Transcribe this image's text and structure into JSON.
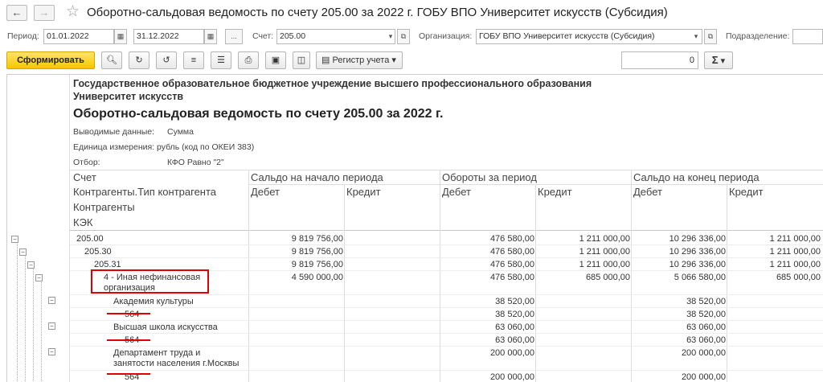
{
  "window": {
    "title": "Оборотно-сальдовая ведомость по счету 205.00 за 2022 г. ГОБУ ВПО Университет искусств (Субсидия)",
    "back_icon": "arrow-left-icon",
    "forward_icon": "arrow-right-icon",
    "favorite_icon": "star-icon"
  },
  "params": {
    "period_label": "Период:",
    "period_from": "01.01.2022",
    "period_to": "31.12.2022",
    "ellipsis": "...",
    "account_label": "Счет:",
    "account_value": "205.00",
    "org_label": "Организация:",
    "org_value": "ГОБУ ВПО Университет искусств (Субсидия)",
    "division_label": "Подразделение:"
  },
  "toolbar": {
    "generate_label": "Сформировать",
    "register_label": "Регистр учета",
    "number_value": "0",
    "sum_label": "Σ"
  },
  "report": {
    "org_line1": "Государственное образовательное бюджетное учреждение высшего профессионального образования",
    "org_line2": "Университет искусств",
    "title": "Оборотно-сальдовая ведомость по счету 205.00 за 2022 г.",
    "output_label": "Выводимые данные:",
    "output_value": "Сумма",
    "unit_label": "Единица измерения:",
    "unit_value": "рубль (код по ОКЕИ 383)",
    "filter_label": "Отбор:",
    "filter_value": "КФО Равно \"2\"",
    "headers": {
      "account": "Счет",
      "contractor_type": "Контрагенты.Тип контрагента",
      "contractors": "Контрагенты",
      "kek": "КЭК",
      "opening": "Сальдо на начало периода",
      "turnover": "Обороты за период",
      "closing": "Сальдо на конец периода",
      "debit": "Дебет",
      "credit": "Кредит"
    },
    "rows": [
      {
        "name": "205.00",
        "od": "9 819 756,00",
        "oc": "",
        "td": "476 580,00",
        "tc": "1 211 000,00",
        "cd": "10 296 336,00",
        "cc": "1 211 000,00"
      },
      {
        "name": "205.30",
        "od": "9 819 756,00",
        "oc": "",
        "td": "476 580,00",
        "tc": "1 211 000,00",
        "cd": "10 296 336,00",
        "cc": "1 211 000,00"
      },
      {
        "name": "205.31",
        "od": "9 819 756,00",
        "oc": "",
        "td": "476 580,00",
        "tc": "1 211 000,00",
        "cd": "10 296 336,00",
        "cc": "1 211 000,00"
      },
      {
        "name": "4 - Иная нефинансовая",
        "name2": "организация",
        "od": "4 590 000,00",
        "oc": "",
        "td": "476 580,00",
        "tc": "685 000,00",
        "cd": "5 066 580,00",
        "cc": "685 000,00"
      },
      {
        "name": "Академия культуры",
        "od": "",
        "oc": "",
        "td": "38 520,00",
        "tc": "",
        "cd": "38 520,00",
        "cc": ""
      },
      {
        "name": "564",
        "od": "",
        "oc": "",
        "td": "38 520,00",
        "tc": "",
        "cd": "38 520,00",
        "cc": ""
      },
      {
        "name": "Высшая школа искусства",
        "od": "",
        "oc": "",
        "td": "63 060,00",
        "tc": "",
        "cd": "63 060,00",
        "cc": ""
      },
      {
        "name": "564",
        "od": "",
        "oc": "",
        "td": "63 060,00",
        "tc": "",
        "cd": "63 060,00",
        "cc": ""
      },
      {
        "name": "Департамент труда и",
        "name2": "занятости населения г.Москвы",
        "od": "",
        "oc": "",
        "td": "200 000,00",
        "tc": "",
        "cd": "200 000,00",
        "cc": ""
      },
      {
        "name": "564",
        "od": "",
        "oc": "",
        "td": "200 000,00",
        "tc": "",
        "cd": "200 000,00",
        "cc": ""
      }
    ]
  },
  "colors": {
    "highlight": "#e00000",
    "generate_button": "#f7c600"
  }
}
